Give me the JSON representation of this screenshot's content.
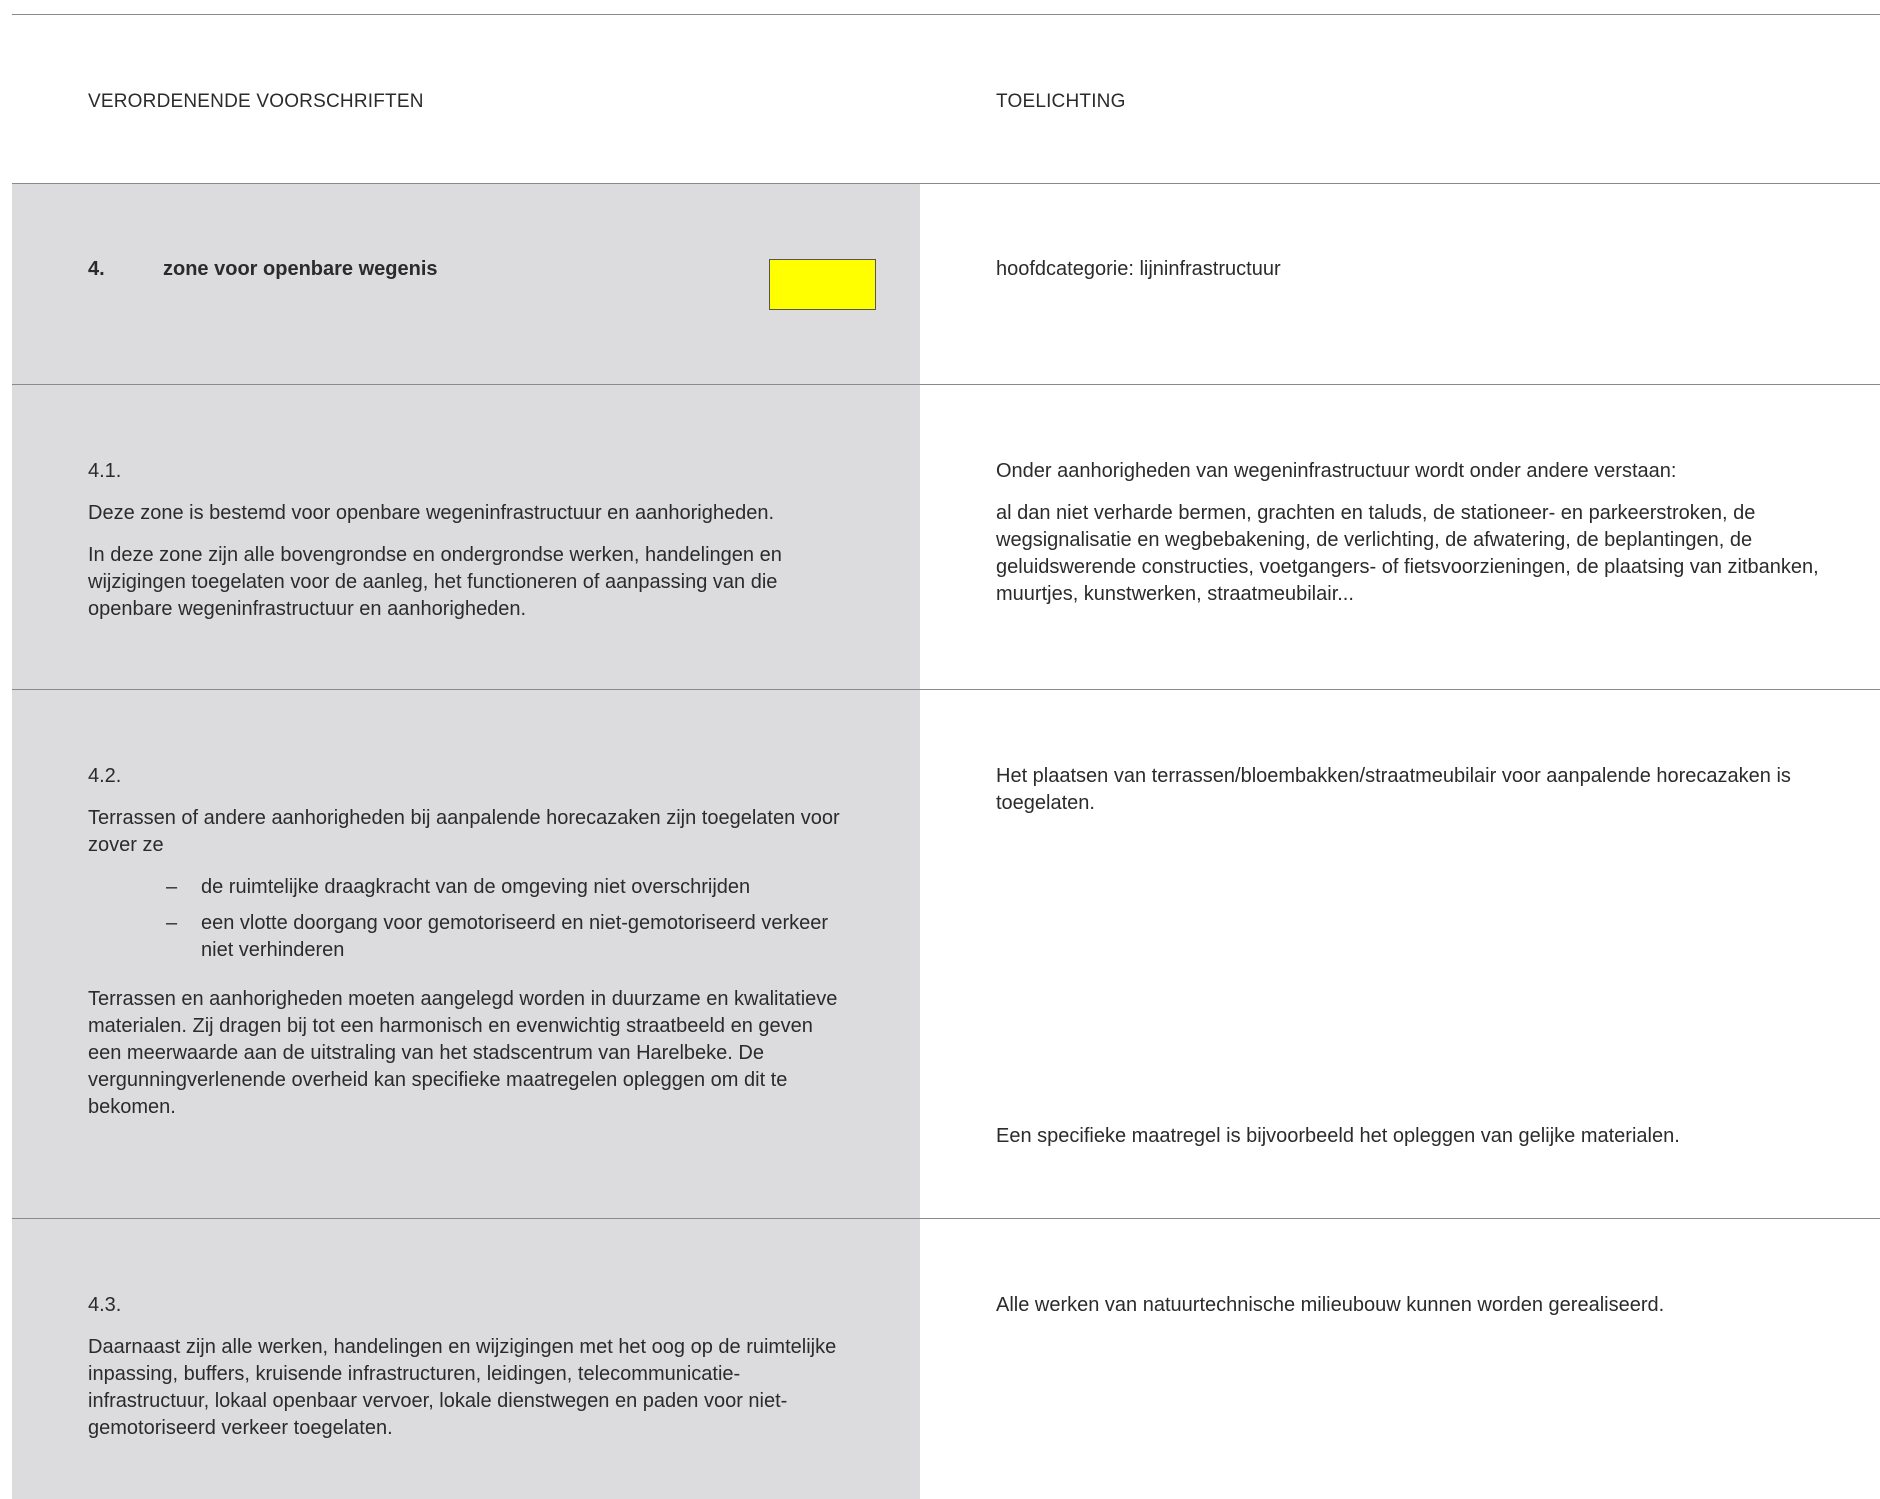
{
  "header": {
    "left_title": "VERORDENENDE VOORSCHRIFTEN",
    "right_title": "TOELICHTING"
  },
  "zone": {
    "number": "4.",
    "title": "zone voor openbare wegenis",
    "color": "#ffff00",
    "category": "hoofdcategorie: lijninfrastructuur"
  },
  "s41": {
    "number": "4.1.",
    "p1": "Deze zone is bestemd voor openbare wegeninfrastructuur en aanhorigheden.",
    "p2": "In deze zone zijn alle bovengrondse en ondergrondse werken, handelingen en wijzigingen toegelaten voor de aanleg, het functioneren of aanpassing van die openbare wegeninfrastructuur en aanhorigheden.",
    "note1": "Onder aanhorigheden van wegeninfrastructuur wordt onder andere verstaan:",
    "note2": "al dan niet verharde bermen, grachten en taluds, de stationeer- en parkeerstroken, de wegsignalisatie en wegbebakening, de verlichting, de afwatering, de beplantingen, de geluidswerende constructies, voetgangers- of fietsvoorzieningen, de plaatsing van zitbanken, muurtjes, kunstwerken, straatmeubilair..."
  },
  "s42": {
    "number": "4.2.",
    "intro": "Terrassen of andere aanhorigheden bij aanpalende horecazaken zijn toegelaten voor zover ze",
    "bullets": [
      "de ruimtelijke draagkracht van de omgeving niet overschrijden",
      "een vlotte doorgang voor gemotoriseerd en niet-gemotoriseerd verkeer niet verhinderen"
    ],
    "p2": "Terrassen en aanhorigheden moeten aangelegd worden in duurzame en kwalitatieve materialen. Zij dragen bij tot een harmonisch en evenwichtig straatbeeld en geven een meerwaarde aan de uitstraling van het stadscentrum van Harelbeke. De vergunningverlenende overheid kan specifieke maatregelen opleggen om dit te bekomen.",
    "note1": "Het plaatsen van terrassen/bloembakken/straatmeubilair voor aanpalende horecazaken is toegelaten.",
    "note2": "Een specifieke maatregel is bijvoorbeeld het opleggen van gelijke materialen."
  },
  "s43": {
    "number": "4.3.",
    "p1": "Daarnaast zijn alle werken, handelingen en wijzigingen met het oog op de ruimtelijke inpassing, buffers, kruisende infrastructuren, leidingen, telecommunicatie-infrastructuur, lokaal openbaar vervoer, lokale dienstwegen en paden voor niet-gemotoriseerd verkeer toegelaten.",
    "note1": "Alle werken van natuurtechnische milieubouw kunnen worden gerealiseerd."
  }
}
